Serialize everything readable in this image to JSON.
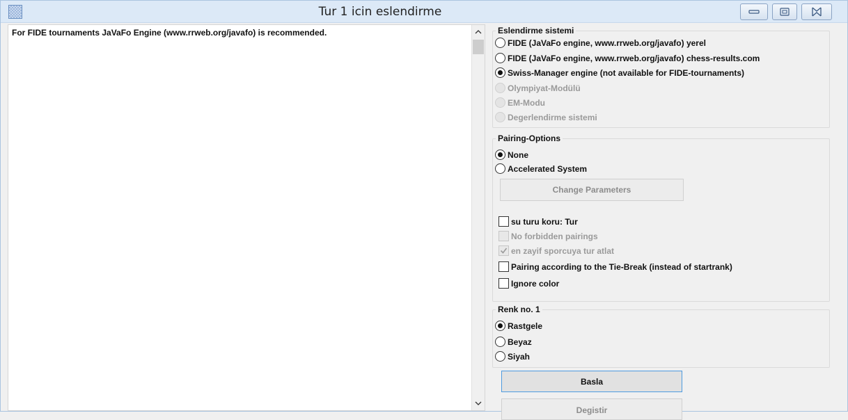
{
  "window": {
    "title": "Tur 1 icin eslendirme",
    "controls": [
      "minimize",
      "maximize",
      "close"
    ]
  },
  "log": {
    "lines": [
      "For FIDE tournaments JaVaFo Engine (www.rrweb.org/javafo) is recommended."
    ]
  },
  "pairing_system": {
    "title": "Eslendirme sistemi",
    "options": [
      {
        "label": "FIDE (JaVaFo engine, www.rrweb.org/javafo) yerel",
        "selected": false,
        "enabled": true
      },
      {
        "label": "FIDE (JaVaFo engine, www.rrweb.org/javafo) chess-results.com",
        "selected": false,
        "enabled": true
      },
      {
        "label": "Swiss-Manager engine (not available for FIDE-tournaments)",
        "selected": true,
        "enabled": true
      },
      {
        "label": "Olympiyat-Modülü",
        "selected": false,
        "enabled": false
      },
      {
        "label": "EM-Modu",
        "selected": false,
        "enabled": false
      },
      {
        "label": "Degerlendirme sistemi",
        "selected": false,
        "enabled": false
      }
    ]
  },
  "pairing_options": {
    "title": "Pairing-Options",
    "radios": [
      {
        "label": "None",
        "selected": true
      },
      {
        "label": "Accelerated System",
        "selected": false
      }
    ],
    "change_button": "Change Parameters",
    "checkboxes": [
      {
        "label": "su turu koru: Tur",
        "checked": false,
        "enabled": true
      },
      {
        "label": "No forbidden pairings",
        "checked": false,
        "enabled": false
      },
      {
        "label": "en zayif sporcuya tur atlat",
        "checked": true,
        "enabled": false
      },
      {
        "label": "Pairing according to the Tie-Break (instead of startrank)",
        "checked": false,
        "enabled": true
      },
      {
        "label": "Ignore color",
        "checked": false,
        "enabled": true
      }
    ]
  },
  "color": {
    "title": "Renk no. 1",
    "options": [
      {
        "label": "Rastgele",
        "selected": true
      },
      {
        "label": "Beyaz",
        "selected": false
      },
      {
        "label": "Siyah",
        "selected": false
      }
    ]
  },
  "buttons": {
    "start": "Basla",
    "change": "Degistir"
  }
}
